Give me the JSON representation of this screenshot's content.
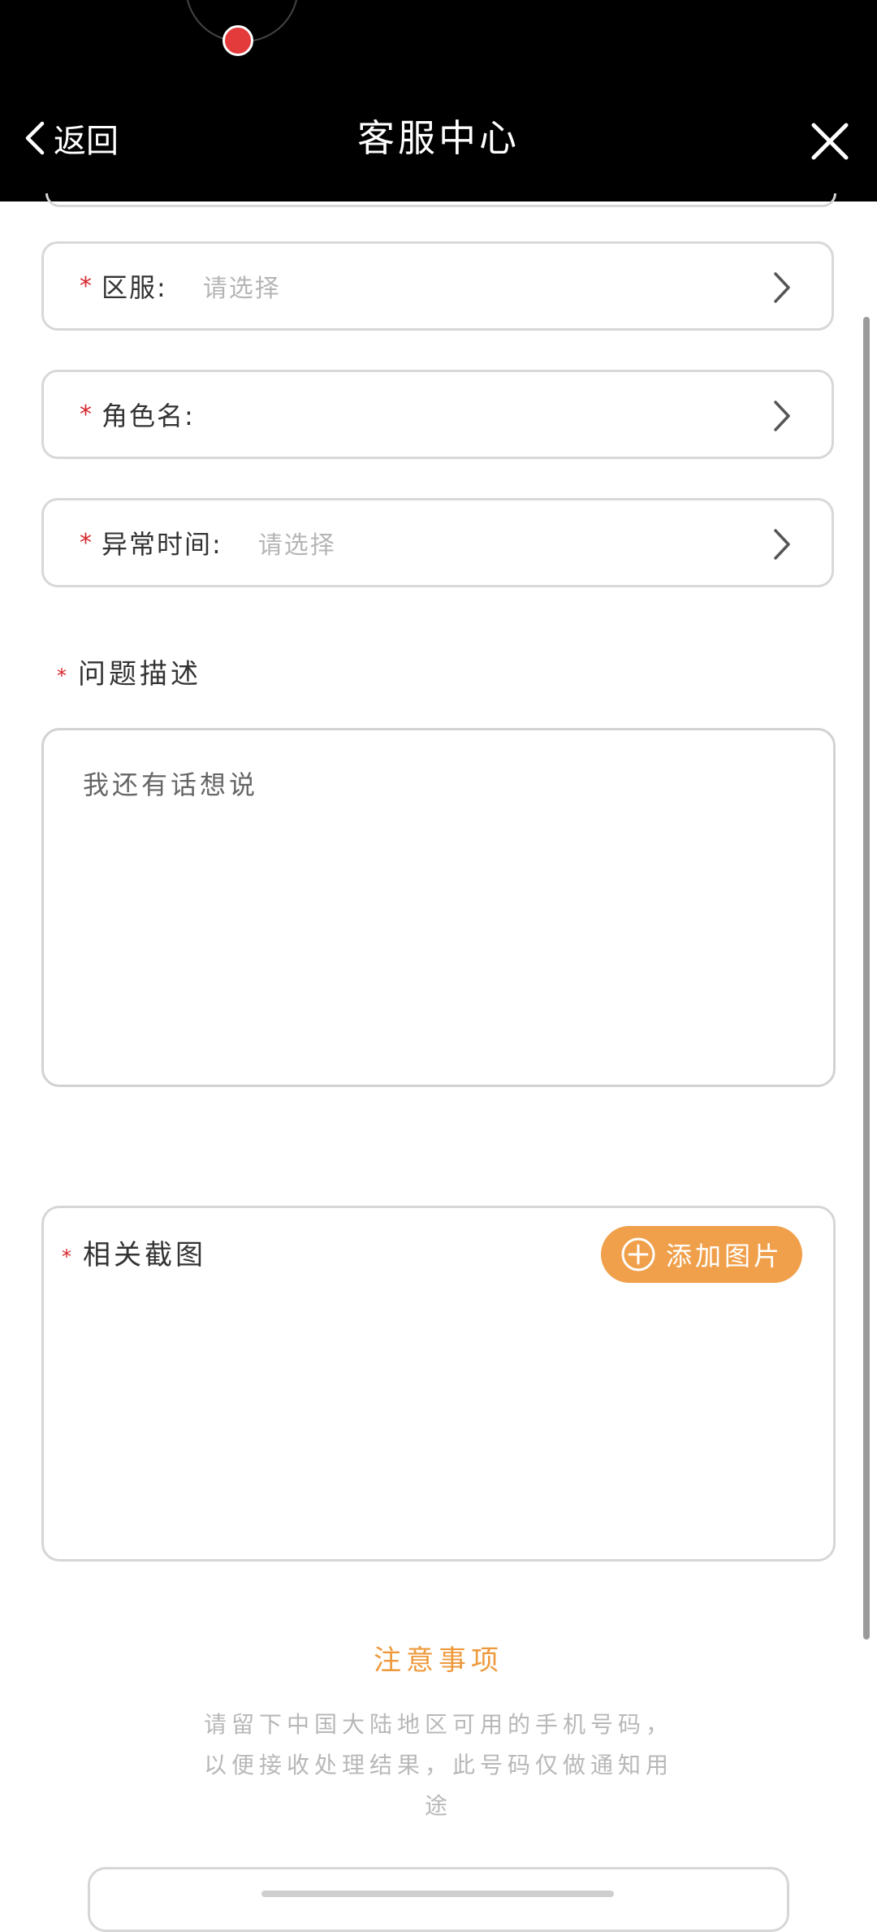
{
  "header": {
    "back_label": "返回",
    "title": "客服中心"
  },
  "form": {
    "required_mark": "*",
    "server": {
      "label": "区服:",
      "placeholder": "请选择"
    },
    "role": {
      "label": "角色名:",
      "value": ""
    },
    "time": {
      "label": "异常时间:",
      "placeholder": "请选择"
    },
    "description": {
      "label": "问题描述",
      "placeholder": "我还有话想说"
    },
    "screenshot": {
      "label": "相关截图",
      "add_button": "添加图片"
    }
  },
  "notice": {
    "title": "注意事项",
    "text": "请留下中国大陆地区可用的手机号码，以便接收处理结果，此号码仅做通知用途"
  },
  "colors": {
    "header_bg": "#000000",
    "accent": "#f0a04b",
    "required": "#d7262c",
    "notice_title": "#ee9a3c"
  },
  "icons": {
    "back": "chevron-left-icon",
    "close": "close-icon",
    "row_arrow": "chevron-right-icon",
    "add": "plus-circle-icon"
  }
}
